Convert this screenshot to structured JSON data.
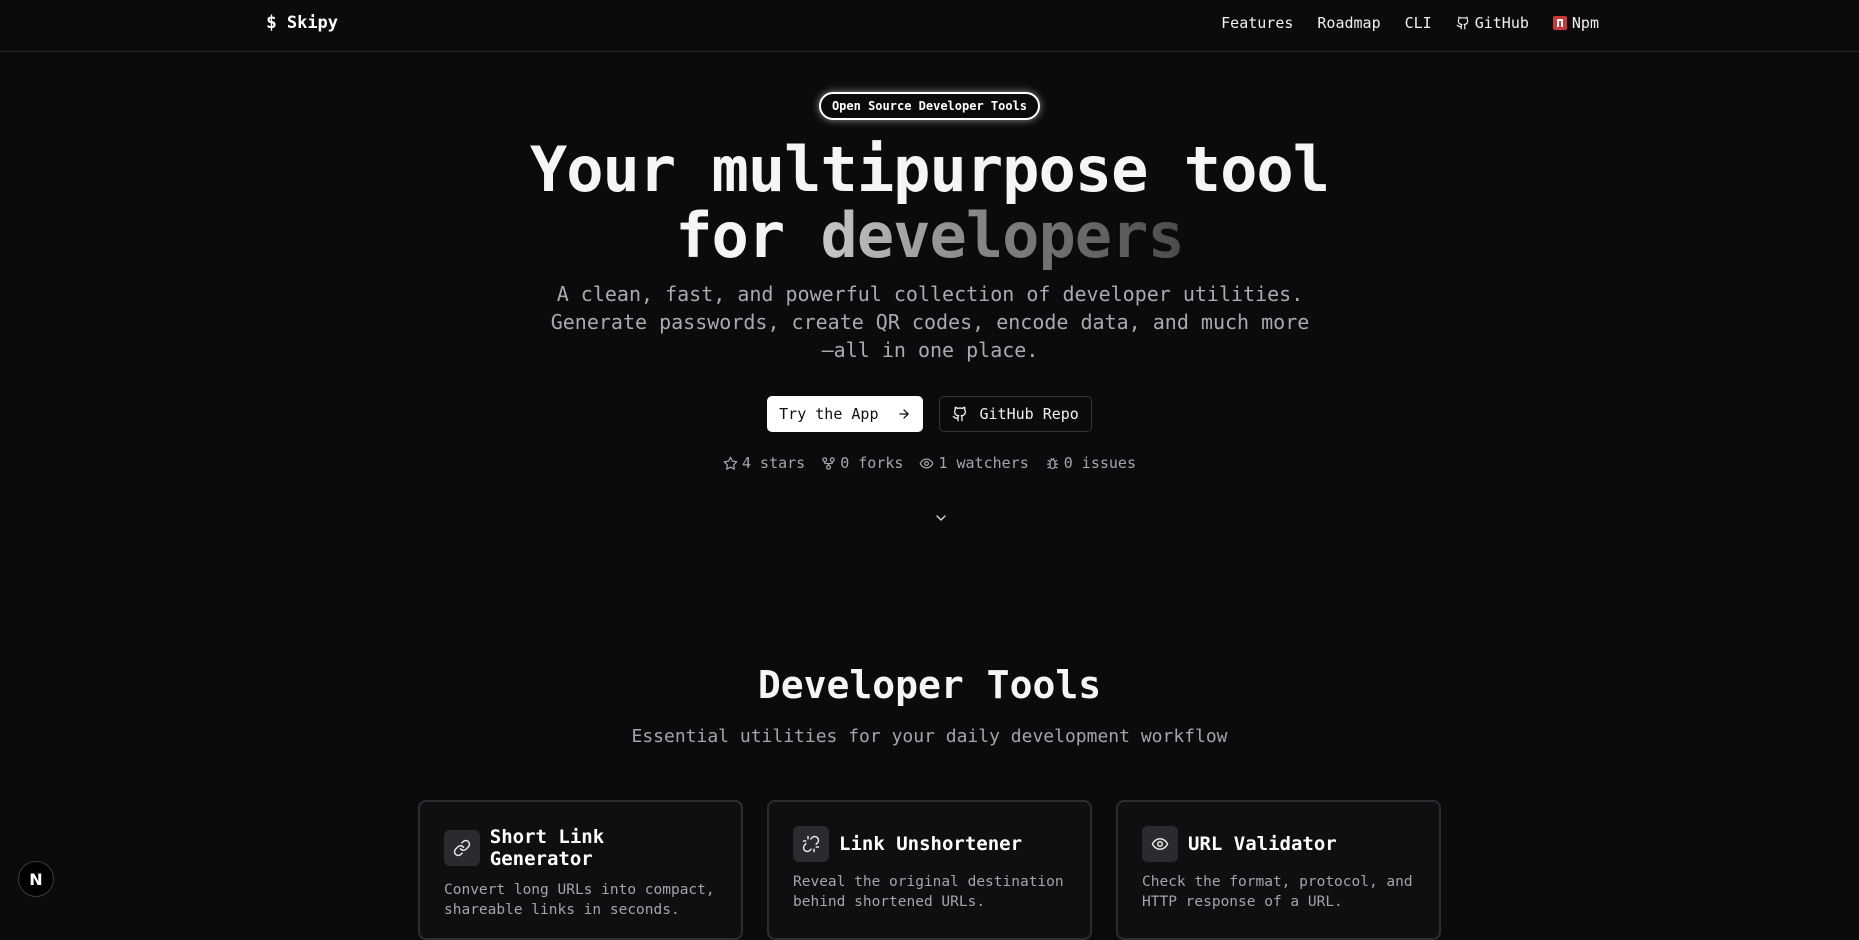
{
  "nav": {
    "brand": "Skipy",
    "links": {
      "features": "Features",
      "roadmap": "Roadmap",
      "cli": "CLI",
      "github": "GitHub",
      "npm": "Npm"
    }
  },
  "hero": {
    "badge": "Open Source Developer Tools",
    "title_line1": "Your multipurpose tool",
    "title_line2_prefix": "for ",
    "title_line2_highlight": "developers",
    "subtitle": "A clean, fast, and powerful collection of developer utilities. Generate passwords, create QR codes, encode data, and much more—all in one place.",
    "primary_cta": "Try the App",
    "secondary_cta": "GitHub Repo",
    "stats": {
      "stars": "4 stars",
      "forks": "0 forks",
      "watchers": "1 watchers",
      "issues": "0 issues"
    }
  },
  "tools": {
    "title": "Developer Tools",
    "subtitle": "Essential utilities for your daily development workflow",
    "cards": [
      {
        "title": "Short Link Generator",
        "description": "Convert long URLs into compact, shareable links in seconds.",
        "icon": "link-icon"
      },
      {
        "title": "Link Unshortener",
        "description": "Reveal the original destination behind shortened URLs.",
        "icon": "unlink-icon"
      },
      {
        "title": "URL Validator",
        "description": "Check the format, protocol, and HTTP response of a URL.",
        "icon": "eye-icon"
      }
    ]
  },
  "dev_badge": "N",
  "colors": {
    "background": "#0b0b0d",
    "card_background": "#0f0f12",
    "muted_text": "#a4a4ab",
    "npm_red": "#cb3837"
  }
}
